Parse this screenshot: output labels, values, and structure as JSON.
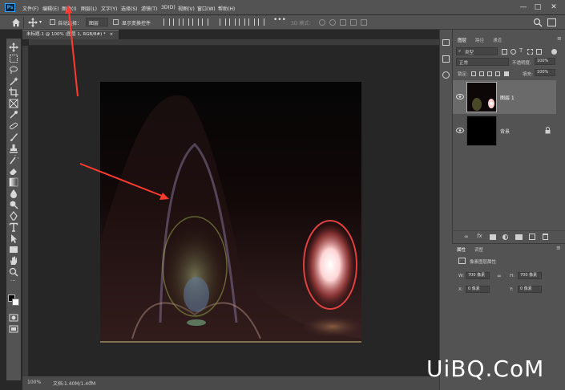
{
  "app": {
    "logo": "Ps"
  },
  "menu": [
    "文件(F)",
    "编辑(E)",
    "图像(I)",
    "图层(L)",
    "文字(Y)",
    "选择(S)",
    "滤镜(T)",
    "3D(D)",
    "视图(V)",
    "窗口(W)",
    "帮助(H)"
  ],
  "window_controls": {
    "minimize": "—",
    "maximize": "□",
    "close": "✕"
  },
  "options_bar": {
    "auto_select_label": "自动选择：",
    "auto_select_target": "图层",
    "show_transform_label": "显示变换控件",
    "mode_3d_label": "3D 模式："
  },
  "document_tab": {
    "title": "未标题-1 @ 100% (图层 1, RGB/8#) *",
    "close": "×"
  },
  "status": {
    "zoom": "100%",
    "doc_size": "文档:1.40M/1.40M",
    "arrow": "›"
  },
  "layers_panel": {
    "tabs": [
      "图层",
      "路径",
      "通道"
    ],
    "filter_kind": "类型",
    "blend_mode": "正常",
    "opacity_label": "不透明度:",
    "opacity_value": "100%",
    "lock_label": "锁定:",
    "fill_label": "填充:",
    "fill_value": "100%",
    "layers": [
      {
        "name": "图层 1",
        "selected": true
      },
      {
        "name": "背景",
        "selected": false,
        "locked": true
      }
    ]
  },
  "properties_panel": {
    "tabs": [
      "属性",
      "调整"
    ],
    "title": "像素图层属性",
    "w_label": "W:",
    "w_value": "700 像素",
    "link_icon": "∞",
    "h_label": "H:",
    "h_value": "700 像素",
    "x_label": "X:",
    "x_value": "0 像素",
    "y_label": "Y:",
    "y_value": "0 像素"
  },
  "watermark": "UiBQ.CoM",
  "colors": {
    "menubar": "#535353",
    "canvas_bg": "#0a0a0a",
    "accent_red": "#ff3b30",
    "selected_layer": "#6a6a6a"
  }
}
